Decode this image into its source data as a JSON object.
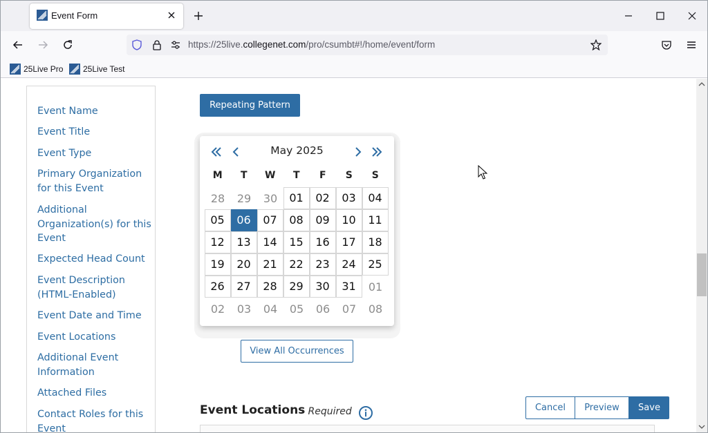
{
  "browser": {
    "tab_title": "Event Form",
    "url_prefix": "https://25live.",
    "url_host": "collegenet.com",
    "url_path": "/pro/csumbt#!/home/event/form",
    "bookmarks": [
      "25Live Pro",
      "25Live Test"
    ]
  },
  "sidebar": {
    "items": [
      "Event Name",
      "Event Title",
      "Event Type",
      "Primary Organization for this Event",
      "Additional Organization(s) for this Event",
      "Expected Head Count",
      "Event Description (HTML-Enabled)",
      "Event Date and Time",
      "Event Locations",
      "Additional Event Information",
      "Attached Files",
      "Contact Roles for this Event"
    ]
  },
  "main": {
    "repeating_pattern_label": "Repeating Pattern",
    "view_all_label": "View All Occurrences",
    "section_title": "Event Locations",
    "section_required": "- Required",
    "cancel_label": "Cancel",
    "preview_label": "Preview",
    "save_label": "Save"
  },
  "calendar": {
    "month_label": "May 2025",
    "weekdays": [
      "M",
      "T",
      "W",
      "T",
      "F",
      "S",
      "S"
    ],
    "selected": "06",
    "weeks": [
      [
        [
          "28",
          "out"
        ],
        [
          "29",
          "out"
        ],
        [
          "30",
          "out"
        ],
        [
          "01",
          "in"
        ],
        [
          "02",
          "in"
        ],
        [
          "03",
          "in"
        ],
        [
          "04",
          "in"
        ]
      ],
      [
        [
          "05",
          "in"
        ],
        [
          "06",
          "sel"
        ],
        [
          "07",
          "in"
        ],
        [
          "08",
          "in"
        ],
        [
          "09",
          "in"
        ],
        [
          "10",
          "in"
        ],
        [
          "11",
          "in"
        ]
      ],
      [
        [
          "12",
          "in"
        ],
        [
          "13",
          "in"
        ],
        [
          "14",
          "in"
        ],
        [
          "15",
          "in"
        ],
        [
          "16",
          "in"
        ],
        [
          "17",
          "in"
        ],
        [
          "18",
          "in"
        ]
      ],
      [
        [
          "19",
          "in"
        ],
        [
          "20",
          "in"
        ],
        [
          "21",
          "in"
        ],
        [
          "22",
          "in"
        ],
        [
          "23",
          "in"
        ],
        [
          "24",
          "in"
        ],
        [
          "25",
          "in"
        ]
      ],
      [
        [
          "26",
          "in"
        ],
        [
          "27",
          "in"
        ],
        [
          "28",
          "in"
        ],
        [
          "29",
          "in"
        ],
        [
          "30",
          "in"
        ],
        [
          "31",
          "in"
        ],
        [
          "01",
          "out"
        ]
      ],
      [
        [
          "02",
          "out"
        ],
        [
          "03",
          "out"
        ],
        [
          "04",
          "out"
        ],
        [
          "05",
          "out"
        ],
        [
          "06",
          "out"
        ],
        [
          "07",
          "out"
        ],
        [
          "08",
          "out"
        ]
      ]
    ]
  },
  "colors": {
    "accent": "#2e6da4",
    "link": "#2d6da3"
  }
}
